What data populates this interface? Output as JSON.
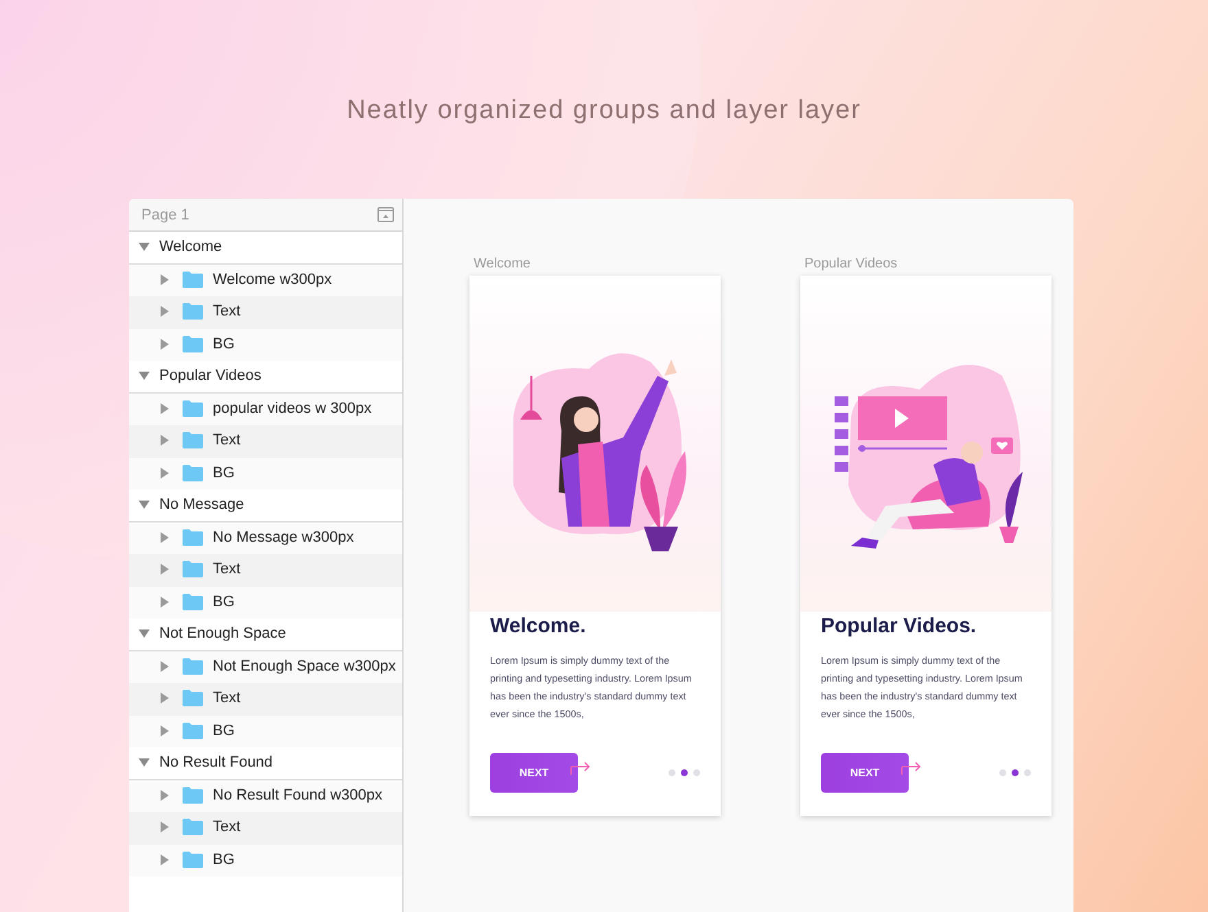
{
  "heading": "Neatly organized groups and layer layer",
  "layers_panel": {
    "page": "Page 1",
    "groups": [
      {
        "name": "Welcome",
        "expanded": true,
        "children": [
          {
            "name": "Welcome w300px",
            "expanded": false
          },
          {
            "name": "Text",
            "expanded": false
          },
          {
            "name": "BG",
            "expanded": false
          }
        ]
      },
      {
        "name": "Popular Videos",
        "expanded": true,
        "children": [
          {
            "name": "popular videos w 300px",
            "expanded": false
          },
          {
            "name": "Text",
            "expanded": false
          },
          {
            "name": "BG",
            "expanded": false
          }
        ]
      },
      {
        "name": "No Message",
        "expanded": true,
        "children": [
          {
            "name": "No Message w300px",
            "expanded": false
          },
          {
            "name": "Text",
            "expanded": false
          },
          {
            "name": "BG",
            "expanded": false
          }
        ]
      },
      {
        "name": "Not Enough Space",
        "expanded": true,
        "children": [
          {
            "name": "Not Enough Space w300px",
            "expanded": false
          },
          {
            "name": "Text",
            "expanded": false
          },
          {
            "name": "BG",
            "expanded": false
          }
        ]
      },
      {
        "name": "No Result Found",
        "expanded": true,
        "children": [
          {
            "name": "No Result Found w300px",
            "expanded": false
          },
          {
            "name": "Text",
            "expanded": false
          },
          {
            "name": "BG",
            "expanded": false
          }
        ]
      }
    ]
  },
  "artboards": [
    {
      "label": "Welcome",
      "kind": "greeting",
      "title": "Welcome.",
      "body": "Lorem Ipsum is simply dummy text of the printing and typesetting industry. Lorem Ipsum has been the industry's standard dummy text ever since the 1500s,",
      "button": "NEXT",
      "dots": [
        {
          "selected": false
        },
        {
          "selected": true
        },
        {
          "selected": false
        }
      ]
    },
    {
      "label": "Popular Videos",
      "kind": "video",
      "title": "Popular Videos.",
      "body": "Lorem Ipsum is simply dummy text of the printing and typesetting industry. Lorem Ipsum has been the industry's standard dummy text ever since the 1500s,",
      "button": "NEXT",
      "dots": [
        {
          "selected": false
        },
        {
          "selected": true
        },
        {
          "selected": false
        }
      ]
    }
  ]
}
